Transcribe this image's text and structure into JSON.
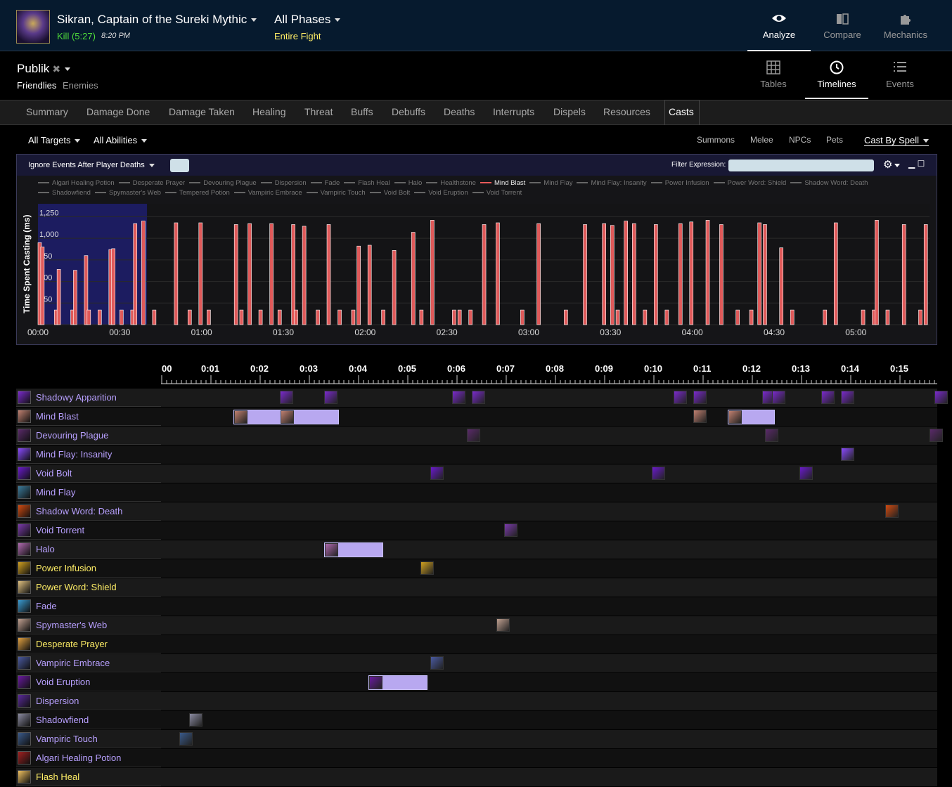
{
  "header": {
    "boss_title": "Sikran, Captain of the Sureki Mythic",
    "kill_label": "Kill (5:27)",
    "kill_time": "8:20 PM",
    "phases_label": "All Phases",
    "fight_label": "Entire Fight",
    "nav": [
      {
        "label": "Analyze",
        "icon": "eye-icon",
        "active": true
      },
      {
        "label": "Compare",
        "icon": "compare-icon",
        "active": false
      },
      {
        "label": "Mechanics",
        "icon": "puzzle-icon",
        "active": false
      }
    ]
  },
  "player": {
    "name": "Publik",
    "friendlies": "Friendlies",
    "enemies": "Enemies",
    "views": [
      {
        "label": "Tables",
        "icon": "grid-icon",
        "active": false
      },
      {
        "label": "Timelines",
        "icon": "clock-icon",
        "active": true
      },
      {
        "label": "Events",
        "icon": "list-icon",
        "active": false
      }
    ]
  },
  "tabs": [
    "Summary",
    "Damage Done",
    "Damage Taken",
    "Healing",
    "Threat",
    "Buffs",
    "Debuffs",
    "Deaths",
    "Interrupts",
    "Dispels",
    "Resources",
    "Casts"
  ],
  "active_tab": "Casts",
  "filters": {
    "targets": "All Targets",
    "abilities": "All Abilities",
    "right": [
      "Summons",
      "Melee",
      "NPCs",
      "Pets"
    ],
    "cast_by": "Cast By Spell"
  },
  "graph": {
    "ignore_label": "Ignore Events After Player Deaths",
    "filter_label": "Filter Expression:",
    "legend": [
      "Algari Healing Potion",
      "Desperate Prayer",
      "Devouring Plague",
      "Dispersion",
      "Fade",
      "Flash Heal",
      "Halo",
      "Healthstone",
      "Mind Blast",
      "Mind Flay",
      "Mind Flay: Insanity",
      "Power Infusion",
      "Power Word: Shield",
      "Shadow Word: Death",
      "Shadowfiend",
      "Spymaster's Web",
      "Tempered Potion",
      "Vampiric Embrace",
      "Vampiric Touch",
      "Void Bolt",
      "Void Eruption",
      "Void Torrent"
    ],
    "legend_active": "Mind Blast"
  },
  "chart_data": {
    "type": "bar",
    "ylabel": "Time Spent Casting (ms)",
    "yticks": [
      "0",
      "250",
      "500",
      "750",
      "1,000",
      "1,250"
    ],
    "ylim": [
      0,
      1400
    ],
    "xticks": [
      "00:00",
      "00:30",
      "01:00",
      "01:30",
      "02:00",
      "02:30",
      "03:00",
      "03:30",
      "04:00",
      "04:30",
      "05:00"
    ],
    "xlim_seconds": [
      0,
      327
    ],
    "highlight_range_seconds": [
      0,
      40
    ],
    "series": [
      {
        "name": "Mind Blast",
        "color": "#e05a5a",
        "x_seconds": [
          0,
          1,
          6,
          7,
          12,
          13,
          17,
          18,
          22,
          26,
          27,
          30,
          34,
          35,
          38,
          42,
          50,
          55,
          59,
          62,
          72,
          74,
          77,
          81,
          85,
          88,
          93,
          94,
          97,
          102,
          106,
          110,
          115,
          117,
          121,
          126,
          130,
          137,
          140,
          144,
          152,
          154,
          158,
          163,
          168,
          177,
          183,
          193,
          200,
          207,
          210,
          212,
          215,
          218,
          222,
          226,
          230,
          235,
          239,
          245,
          250,
          256,
          261,
          266,
          264,
          272,
          276,
          288,
          292,
          302,
          306,
          307,
          311,
          317,
          323,
          325
        ],
        "values": [
          950,
          900,
          170,
          640,
          170,
          630,
          800,
          170,
          170,
          870,
          880,
          170,
          170,
          1170,
          1200,
          170,
          1180,
          170,
          1180,
          170,
          1160,
          170,
          1170,
          170,
          1170,
          170,
          1160,
          170,
          1140,
          170,
          1160,
          170,
          170,
          910,
          920,
          170,
          860,
          1070,
          170,
          1210,
          170,
          170,
          170,
          1160,
          1180,
          170,
          1170,
          170,
          1160,
          1170,
          1150,
          170,
          1200,
          1170,
          170,
          1160,
          170,
          1170,
          1190,
          1210,
          1160,
          170,
          170,
          1160,
          1180,
          890,
          170,
          170,
          1180,
          170,
          170,
          1210,
          170,
          1160,
          170,
          1160
        ]
      }
    ]
  },
  "timeline": {
    "ticks": [
      "00",
      "0:01",
      "0:02",
      "0:03",
      "0:04",
      "0:05",
      "0:06",
      "0:07",
      "0:08",
      "0:09",
      "0:10",
      "0:11",
      "0:12",
      "0:13",
      "0:14",
      "0:15"
    ],
    "rows": [
      {
        "name": "Shadowy Apparition",
        "color": "purple",
        "icon": "#7a2acc",
        "casts": [
          [
            2.4,
            0
          ],
          [
            3.3,
            0
          ],
          [
            5.9,
            0
          ],
          [
            6.3,
            0
          ],
          [
            10.4,
            0
          ],
          [
            10.8,
            0
          ],
          [
            12.2,
            0
          ],
          [
            12.4,
            0
          ],
          [
            13.4,
            0
          ],
          [
            13.8,
            0
          ],
          [
            15.7,
            0
          ]
        ]
      },
      {
        "name": "Mind Blast",
        "color": "purple",
        "icon": "#c08070",
        "casts": [
          [
            1.45,
            0.95
          ],
          [
            2.4,
            0.9
          ],
          [
            10.8,
            0
          ],
          [
            11.5,
            0.65
          ]
        ]
      },
      {
        "name": "Devouring Plague",
        "color": "purple",
        "icon": "#5a2a6a",
        "casts": [
          [
            6.2,
            0
          ],
          [
            12.25,
            0
          ],
          [
            15.6,
            0
          ]
        ]
      },
      {
        "name": "Mind Flay: Insanity",
        "color": "purple",
        "icon": "#8a4aff",
        "casts": [
          [
            13.8,
            0
          ]
        ]
      },
      {
        "name": "Void Bolt",
        "color": "purple",
        "icon": "#6a1acc",
        "casts": [
          [
            5.45,
            0
          ],
          [
            9.95,
            0
          ],
          [
            12.95,
            0
          ]
        ]
      },
      {
        "name": "Mind Flay",
        "color": "purple",
        "icon": "#3a7a9a",
        "casts": []
      },
      {
        "name": "Shadow Word: Death",
        "color": "purple",
        "icon": "#d04a10",
        "casts": [
          [
            14.7,
            0
          ]
        ]
      },
      {
        "name": "Void Torrent",
        "color": "purple",
        "icon": "#7a3aaa",
        "casts": [
          [
            6.95,
            0
          ]
        ]
      },
      {
        "name": "Halo",
        "color": "purple",
        "icon": "#b06ab0",
        "casts": [
          [
            3.3,
            0.9
          ]
        ]
      },
      {
        "name": "Power Infusion",
        "color": "yellow",
        "icon": "#d0a020",
        "casts": [
          [
            5.25,
            0
          ]
        ]
      },
      {
        "name": "Power Word: Shield",
        "color": "yellow",
        "icon": "#e0c080",
        "casts": []
      },
      {
        "name": "Fade",
        "color": "purple",
        "icon": "#3a9ad0",
        "casts": []
      },
      {
        "name": "Spymaster's Web",
        "color": "purple",
        "icon": "#c0a090",
        "casts": [
          [
            6.8,
            0
          ]
        ]
      },
      {
        "name": "Desperate Prayer",
        "color": "yellow",
        "icon": "#e0a040",
        "casts": []
      },
      {
        "name": "Vampiric Embrace",
        "color": "purple",
        "icon": "#4a5aa0",
        "casts": [
          [
            5.45,
            0
          ]
        ]
      },
      {
        "name": "Void Eruption",
        "color": "purple",
        "icon": "#6a1aa0",
        "casts": [
          [
            4.2,
            0.9
          ]
        ]
      },
      {
        "name": "Dispersion",
        "color": "purple",
        "icon": "#5a2a9a",
        "casts": []
      },
      {
        "name": "Shadowfiend",
        "color": "purple",
        "icon": "#8a8aa0",
        "casts": [
          [
            0.55,
            0
          ]
        ]
      },
      {
        "name": "Vampiric Touch",
        "color": "purple",
        "icon": "#3a5a8a",
        "casts": [
          [
            0.35,
            0
          ]
        ]
      },
      {
        "name": "Algari Healing Potion",
        "color": "purple",
        "icon": "#a02020",
        "casts": []
      },
      {
        "name": "Flash Heal",
        "color": "yellow",
        "icon": "#f0c060",
        "casts": []
      }
    ]
  }
}
